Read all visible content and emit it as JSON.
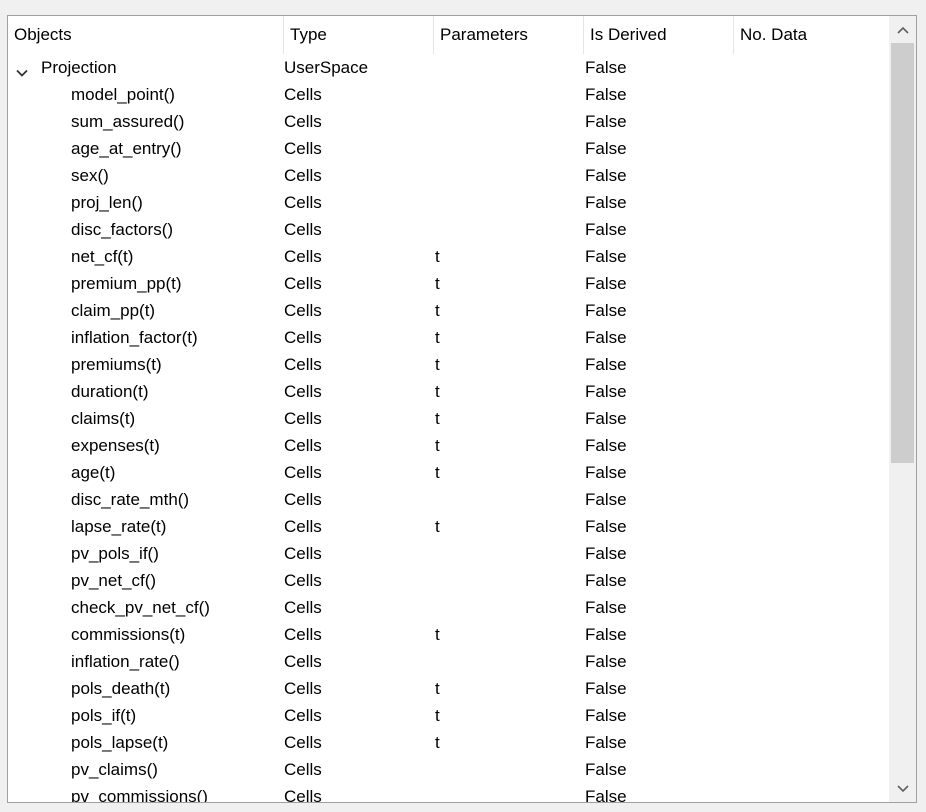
{
  "columns": {
    "objects": "Objects",
    "type": "Type",
    "parameters": "Parameters",
    "is_derived": "Is Derived",
    "no_data": "No. Data"
  },
  "root": {
    "name": "Projection",
    "type": "UserSpace",
    "parameters": "",
    "is_derived": "False",
    "no_data": ""
  },
  "rows": [
    {
      "name": "model_point()",
      "type": "Cells",
      "parameters": "",
      "is_derived": "False"
    },
    {
      "name": "sum_assured()",
      "type": "Cells",
      "parameters": "",
      "is_derived": "False"
    },
    {
      "name": "age_at_entry()",
      "type": "Cells",
      "parameters": "",
      "is_derived": "False"
    },
    {
      "name": "sex()",
      "type": "Cells",
      "parameters": "",
      "is_derived": "False"
    },
    {
      "name": "proj_len()",
      "type": "Cells",
      "parameters": "",
      "is_derived": "False"
    },
    {
      "name": "disc_factors()",
      "type": "Cells",
      "parameters": "",
      "is_derived": "False"
    },
    {
      "name": "net_cf(t)",
      "type": "Cells",
      "parameters": "t",
      "is_derived": "False"
    },
    {
      "name": "premium_pp(t)",
      "type": "Cells",
      "parameters": "t",
      "is_derived": "False"
    },
    {
      "name": "claim_pp(t)",
      "type": "Cells",
      "parameters": "t",
      "is_derived": "False"
    },
    {
      "name": "inflation_factor(t)",
      "type": "Cells",
      "parameters": "t",
      "is_derived": "False"
    },
    {
      "name": "premiums(t)",
      "type": "Cells",
      "parameters": "t",
      "is_derived": "False"
    },
    {
      "name": "duration(t)",
      "type": "Cells",
      "parameters": "t",
      "is_derived": "False"
    },
    {
      "name": "claims(t)",
      "type": "Cells",
      "parameters": "t",
      "is_derived": "False"
    },
    {
      "name": "expenses(t)",
      "type": "Cells",
      "parameters": "t",
      "is_derived": "False"
    },
    {
      "name": "age(t)",
      "type": "Cells",
      "parameters": "t",
      "is_derived": "False"
    },
    {
      "name": "disc_rate_mth()",
      "type": "Cells",
      "parameters": "",
      "is_derived": "False"
    },
    {
      "name": "lapse_rate(t)",
      "type": "Cells",
      "parameters": "t",
      "is_derived": "False"
    },
    {
      "name": "pv_pols_if()",
      "type": "Cells",
      "parameters": "",
      "is_derived": "False"
    },
    {
      "name": "pv_net_cf()",
      "type": "Cells",
      "parameters": "",
      "is_derived": "False"
    },
    {
      "name": "check_pv_net_cf()",
      "type": "Cells",
      "parameters": "",
      "is_derived": "False"
    },
    {
      "name": "commissions(t)",
      "type": "Cells",
      "parameters": "t",
      "is_derived": "False"
    },
    {
      "name": "inflation_rate()",
      "type": "Cells",
      "parameters": "",
      "is_derived": "False"
    },
    {
      "name": "pols_death(t)",
      "type": "Cells",
      "parameters": "t",
      "is_derived": "False"
    },
    {
      "name": "pols_if(t)",
      "type": "Cells",
      "parameters": "t",
      "is_derived": "False"
    },
    {
      "name": "pols_lapse(t)",
      "type": "Cells",
      "parameters": "t",
      "is_derived": "False"
    },
    {
      "name": "pv_claims()",
      "type": "Cells",
      "parameters": "",
      "is_derived": "False"
    },
    {
      "name": "pv_commissions()",
      "type": "Cells",
      "parameters": "",
      "is_derived": "False"
    }
  ],
  "icons": {
    "expander": "chevron-down-icon",
    "scroll_up": "chevron-up-icon",
    "scroll_down": "chevron-down-icon"
  },
  "colors": {
    "scroll_thumb": "#cdcdcd",
    "border": "#a0a0a0",
    "background": "#ffffff"
  },
  "scroll": {
    "visible_fraction": 0.57,
    "position_fraction": 0.0
  }
}
